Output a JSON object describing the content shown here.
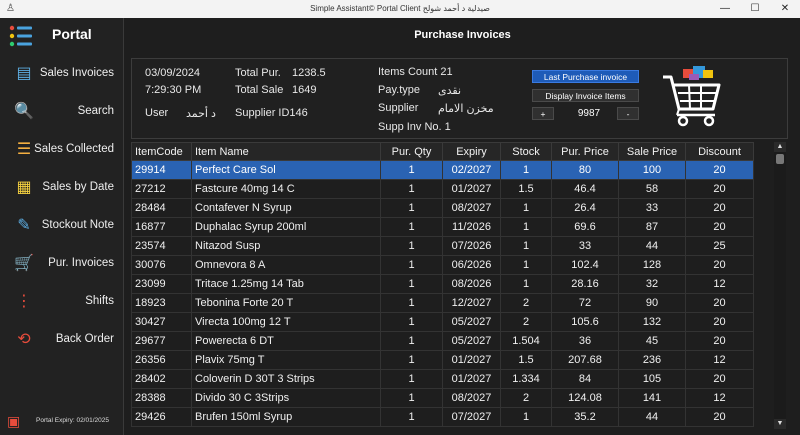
{
  "window": {
    "title": "Simple Assistant© Portal Client صيدلية د أحمد شولح",
    "min_icon": "minimize-icon",
    "max_icon": "maximize-icon",
    "close_icon": "close-icon"
  },
  "sidebar": {
    "title": "Portal",
    "items": [
      {
        "label": "Sales Invoices",
        "icon": "sales-invoices-icon"
      },
      {
        "label": "Search",
        "icon": "search-icon"
      },
      {
        "label": "Sales Collected",
        "icon": "sales-collected-icon"
      },
      {
        "label": "Sales by Date",
        "icon": "sales-by-date-icon"
      },
      {
        "label": "Stockout Note",
        "icon": "stockout-note-icon"
      },
      {
        "label": "Pur. Invoices",
        "icon": "purchase-invoices-icon"
      },
      {
        "label": "Shifts",
        "icon": "shifts-icon"
      },
      {
        "label": "Back Order",
        "icon": "back-order-icon"
      }
    ],
    "footer": "Portal Expiry: 02/01/2025"
  },
  "page": {
    "title": "Purchase Invoices"
  },
  "invoice": {
    "date": "03/09/2024",
    "time": "7:29:30 PM",
    "user_label": "User",
    "user": "د أحمد",
    "total_pur_label": "Total Pur.",
    "total_pur": "1238.5",
    "total_sale_label": "Total Sale",
    "total_sale": "1649",
    "supplier_id_label": "Supplier ID",
    "supplier_id": "146",
    "items_count_label": "Items Count",
    "items_count": "21",
    "pay_type_label": "Pay.type",
    "pay_type": "نقدى",
    "supplier_label": "Supplier",
    "supplier": "مخزن الامام",
    "supp_inv_label": "Supp Inv No.",
    "supp_inv": "1"
  },
  "actions": {
    "last_purchase": "Last Purchase invoice",
    "display_items": "Display Invoice Items",
    "plus": "+",
    "minus": "-",
    "invoice_number": "9987"
  },
  "table": {
    "columns": [
      "ItemCode",
      "Item Name",
      "Pur. Qty",
      "Expiry",
      "Stock",
      "Pur. Price",
      "Sale Price",
      "Discount"
    ],
    "selected_index": 0,
    "rows": [
      [
        "29914",
        "Perfect Care Sol",
        "1",
        "02/2027",
        "1",
        "80",
        "100",
        "20"
      ],
      [
        "27212",
        "Fastcure 40mg 14 C",
        "1",
        "01/2027",
        "1.5",
        "46.4",
        "58",
        "20"
      ],
      [
        "28484",
        "Contafever N Syrup",
        "1",
        "08/2027",
        "1",
        "26.4",
        "33",
        "20"
      ],
      [
        "16877",
        "Duphalac Syrup 200ml",
        "1",
        "11/2026",
        "1",
        "69.6",
        "87",
        "20"
      ],
      [
        "23574",
        "Nitazod Susp",
        "1",
        "07/2026",
        "1",
        "33",
        "44",
        "25"
      ],
      [
        "30076",
        "Omnevora 8 A",
        "1",
        "06/2026",
        "1",
        "102.4",
        "128",
        "20"
      ],
      [
        "23099",
        "Tritace 1.25mg 14 Tab",
        "1",
        "08/2026",
        "1",
        "28.16",
        "32",
        "12"
      ],
      [
        "18923",
        "Tebonina Forte 20 T",
        "1",
        "12/2027",
        "2",
        "72",
        "90",
        "20"
      ],
      [
        "30427",
        "Virecta 100mg 12 T",
        "1",
        "05/2027",
        "2",
        "105.6",
        "132",
        "20"
      ],
      [
        "29677",
        "Powerecta 6 DT",
        "1",
        "05/2027",
        "1.504",
        "36",
        "45",
        "20"
      ],
      [
        "26356",
        "Plavix 75mg T",
        "1",
        "01/2027",
        "1.5",
        "207.68",
        "236",
        "12"
      ],
      [
        "28402",
        "Coloverin D 30T 3 Strips",
        "1",
        "01/2027",
        "1.334",
        "84",
        "105",
        "20"
      ],
      [
        "28388",
        "Divido 30 C 3Strips",
        "1",
        "08/2027",
        "2",
        "124.08",
        "141",
        "12"
      ],
      [
        "29426",
        "Brufen 150ml Syrup",
        "1",
        "07/2027",
        "1",
        "35.2",
        "44",
        "20"
      ]
    ]
  },
  "colors": {
    "accent": "#1e5bb8",
    "selected_row": "#2a63b3",
    "background": "#1e1e1e"
  }
}
